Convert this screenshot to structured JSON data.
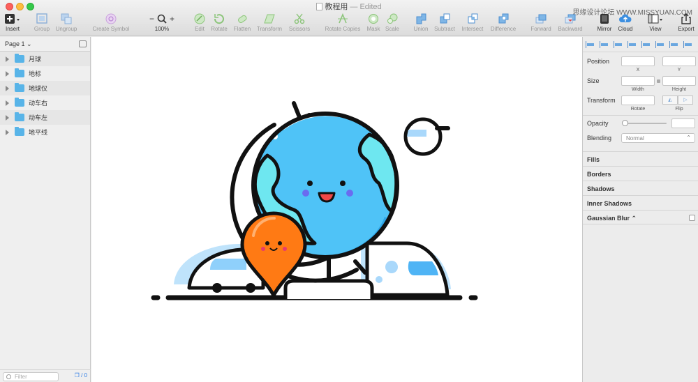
{
  "window": {
    "title": "教程用",
    "edited_label": "— Edited",
    "watermark": "思缘设计论坛  WWW.MISSYUAN.COM"
  },
  "toolbar": {
    "insert": "Insert",
    "group": "Group",
    "ungroup": "Ungroup",
    "create_symbol": "Create Symbol",
    "zoom_minus": "−",
    "zoom_plus": "+",
    "zoom_level": "100%",
    "edit": "Edit",
    "rotate": "Rotate",
    "flatten": "Flatten",
    "transform": "Transform",
    "scissors": "Scissors",
    "rotate_copies": "Rotate Copies",
    "mask": "Mask",
    "scale": "Scale",
    "union": "Union",
    "subtract": "Subtract",
    "intersect": "Intersect",
    "difference": "Difference",
    "forward": "Forward",
    "backward": "Backward",
    "mirror": "Mirror",
    "cloud": "Cloud",
    "view": "View",
    "export": "Export"
  },
  "sidebar": {
    "page_selector": "Page 1 ⌄",
    "layers": [
      {
        "label": "月球"
      },
      {
        "label": "地标"
      },
      {
        "label": "地球仪"
      },
      {
        "label": "动车右"
      },
      {
        "label": "动车左"
      },
      {
        "label": "地平线"
      }
    ],
    "filter_placeholder": "Filter",
    "filter_count": "0"
  },
  "inspector": {
    "position_label": "Position",
    "x_label": "X",
    "y_label": "Y",
    "size_label": "Size",
    "width_label": "Width",
    "height_label": "Height",
    "transform_label": "Transform",
    "rotate_label": "Rotate",
    "flip_label": "Flip",
    "opacity_label": "Opacity",
    "blending_label": "Blending",
    "blending_value": "Normal",
    "fills": "Fills",
    "borders": "Borders",
    "shadows": "Shadows",
    "inner_shadows": "Inner Shadows",
    "gaussian_blur": "Gaussian Blur ⌃"
  },
  "colors": {
    "globe_blue": "#4fc3f7",
    "globe_cyan": "#6ee7f0",
    "pin_orange": "#ff7a14",
    "outline": "#111111",
    "shadow_blue": "#bfe3fb",
    "cheek": "#6a6cf0",
    "mouth": "#f04848"
  }
}
